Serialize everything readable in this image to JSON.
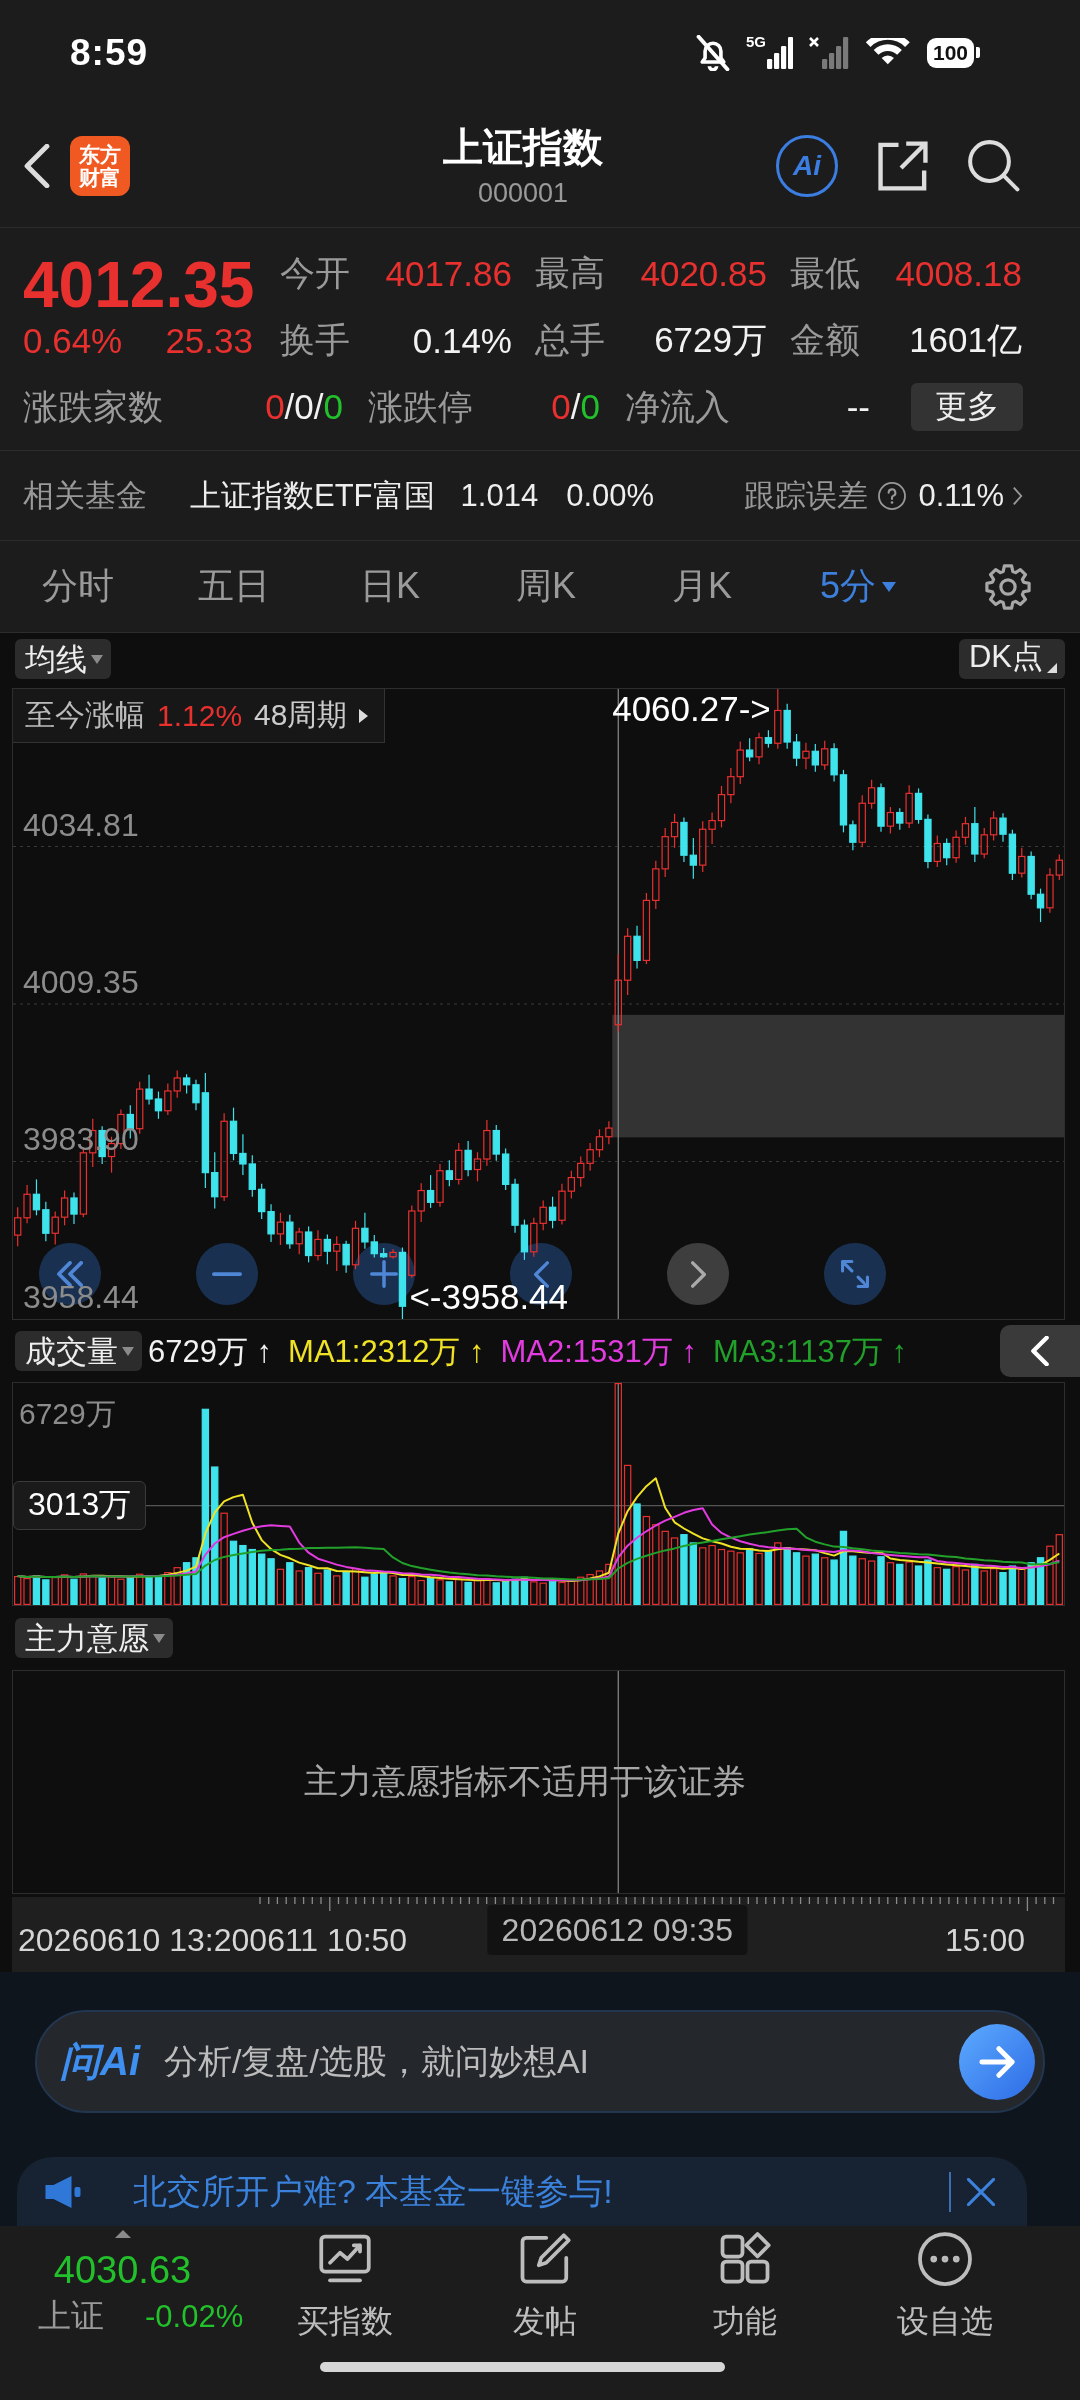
{
  "status_bar": {
    "time": "8:59",
    "network": "5G",
    "battery": "100"
  },
  "header": {
    "logo": [
      "东方",
      "财富"
    ],
    "title": "上证指数",
    "code": "000001",
    "ai_button": "Ai"
  },
  "quote": {
    "price": "4012.35",
    "change_pct": "0.64%",
    "change": "25.33",
    "stats": [
      {
        "label": "今开",
        "value": "4017.86",
        "color": "#e8302f"
      },
      {
        "label": "最高",
        "value": "4020.85",
        "color": "#e8302f"
      },
      {
        "label": "最低",
        "value": "4008.18",
        "color": "#e8302f"
      },
      {
        "label": "换手",
        "value": "0.14%",
        "color": "#f2f2f2"
      },
      {
        "label": "总手",
        "value": "6729万",
        "color": "#f2f2f2"
      },
      {
        "label": "金额",
        "value": "1601亿",
        "color": "#f2f2f2"
      }
    ],
    "breadth": [
      {
        "label": "涨跌家数",
        "parts": [
          {
            "text": "0",
            "color": "#e8302f"
          },
          {
            "text": "/0/",
            "color": "#f2f2f2"
          },
          {
            "text": "0",
            "color": "#22c02a"
          }
        ]
      },
      {
        "label": "涨跌停",
        "parts": [
          {
            "text": "0",
            "color": "#e8302f"
          },
          {
            "text": "/",
            "color": "#f2f2f2"
          },
          {
            "text": "0",
            "color": "#22c02a"
          }
        ]
      },
      {
        "label": "净流入",
        "parts": [
          {
            "text": "--",
            "color": "#f2f2f2"
          }
        ]
      }
    ],
    "more_button": "更多"
  },
  "related_fund": {
    "label": "相关基金",
    "name": "上证指数ETF富国",
    "price": "1.014",
    "change": "0.00%",
    "tracking_label": "跟踪误差",
    "tracking_value": "0.11%"
  },
  "period_tabs": [
    {
      "label": "分时",
      "selected": false,
      "kind": "plain"
    },
    {
      "label": "五日",
      "selected": false,
      "kind": "plain"
    },
    {
      "label": "日K",
      "selected": false,
      "kind": "plain"
    },
    {
      "label": "周K",
      "selected": false,
      "kind": "plain"
    },
    {
      "label": "月K",
      "selected": false,
      "kind": "plain"
    },
    {
      "label": "5分",
      "selected": true,
      "kind": "menu"
    }
  ],
  "kline": {
    "indicator": "均线",
    "dk_button": "DK点",
    "range_label": "至今涨幅",
    "range_change": "1.12%",
    "range_periods": "48周期",
    "controls": [
      {
        "disabled": false
      },
      {
        "disabled": false
      },
      {
        "disabled": false
      },
      {
        "disabled": false
      },
      {
        "disabled": true
      },
      {
        "disabled": false
      }
    ],
    "chart_data": {
      "type": "candlestick",
      "grid": true,
      "ohlc": [
        [
          3972.0,
          3976.5,
          3970.2,
          3974.8
        ],
        [
          3974.8,
          3980.1,
          3973.9,
          3978.6
        ],
        [
          3978.6,
          3981.0,
          3975.2,
          3976.1
        ],
        [
          3976.1,
          3977.4,
          3971.0,
          3972.3
        ],
        [
          3972.3,
          3975.8,
          3970.5,
          3974.9
        ],
        [
          3974.9,
          3979.2,
          3973.6,
          3978.0
        ],
        [
          3978.0,
          3978.9,
          3973.8,
          3975.4
        ],
        [
          3975.4,
          3986.2,
          3974.9,
          3985.3
        ],
        [
          3985.3,
          3990.8,
          3983.0,
          3988.9
        ],
        [
          3988.9,
          3989.6,
          3983.5,
          3984.7
        ],
        [
          3984.7,
          3987.9,
          3982.1,
          3986.8
        ],
        [
          3986.8,
          3992.3,
          3985.9,
          3991.5
        ],
        [
          3991.5,
          3993.0,
          3987.6,
          3989.2
        ],
        [
          3989.2,
          3996.8,
          3988.4,
          3995.6
        ],
        [
          3995.6,
          3997.9,
          3993.1,
          3994.0
        ],
        [
          3994.0,
          3995.2,
          3990.8,
          3992.1
        ],
        [
          3992.1,
          3996.5,
          3991.4,
          3995.3
        ],
        [
          3995.3,
          3998.6,
          3994.2,
          3997.4
        ],
        [
          3997.4,
          3998.0,
          3994.9,
          3996.3
        ],
        [
          3996.3,
          3997.1,
          3992.2,
          3993.4
        ],
        [
          3995.0,
          3998.2,
          3979.6,
          3982.1
        ],
        [
          3982.1,
          3985.4,
          3976.3,
          3978.2
        ],
        [
          3978.2,
          3991.7,
          3977.5,
          3990.4
        ],
        [
          3990.4,
          3992.6,
          3984.1,
          3985.2
        ],
        [
          3985.2,
          3988.3,
          3981.7,
          3983.5
        ],
        [
          3983.5,
          3984.9,
          3978.2,
          3979.4
        ],
        [
          3979.4,
          3980.3,
          3974.6,
          3975.8
        ],
        [
          3975.8,
          3977.0,
          3970.9,
          3972.2
        ],
        [
          3972.2,
          3975.6,
          3970.4,
          3974.1
        ],
        [
          3974.1,
          3975.3,
          3969.8,
          3970.6
        ],
        [
          3970.6,
          3973.2,
          3968.9,
          3972.5
        ],
        [
          3972.5,
          3973.4,
          3967.6,
          3968.7
        ],
        [
          3968.7,
          3972.8,
          3967.9,
          3971.3
        ],
        [
          3971.3,
          3972.1,
          3967.3,
          3969.4
        ],
        [
          3969.4,
          3971.8,
          3966.2,
          3970.5
        ],
        [
          3970.5,
          3971.1,
          3965.9,
          3967.2
        ],
        [
          3967.2,
          3974.3,
          3966.5,
          3973.1
        ],
        [
          3973.1,
          3975.6,
          3969.8,
          3970.9
        ],
        [
          3970.9,
          3972.0,
          3968.4,
          3969.0
        ],
        [
          3969.0,
          3969.9,
          3968.3,
          3968.5
        ],
        [
          3968.5,
          3969.7,
          3968.2,
          3969.2
        ],
        [
          3969.2,
          3970.0,
          3958.44,
          3960.5
        ],
        [
          3965.5,
          3976.8,
          3965.1,
          3975.9
        ],
        [
          3975.9,
          3980.4,
          3974.1,
          3979.2
        ],
        [
          3979.2,
          3981.7,
          3976.4,
          3977.3
        ],
        [
          3977.3,
          3983.5,
          3976.6,
          3982.4
        ],
        [
          3982.4,
          3984.1,
          3979.9,
          3981.0
        ],
        [
          3981.0,
          3986.9,
          3980.2,
          3985.7
        ],
        [
          3985.7,
          3987.2,
          3981.5,
          3982.6
        ],
        [
          3982.6,
          3985.4,
          3980.7,
          3984.3
        ],
        [
          3984.3,
          3990.6,
          3983.2,
          3988.9
        ],
        [
          3988.9,
          3989.8,
          3984.0,
          3985.1
        ],
        [
          3985.1,
          3986.0,
          3979.3,
          3980.2
        ],
        [
          3980.2,
          3981.1,
          3972.4,
          3973.6
        ],
        [
          3973.6,
          3974.5,
          3968.0,
          3969.3
        ],
        [
          3969.3,
          3974.8,
          3968.5,
          3973.9
        ],
        [
          3973.9,
          3977.6,
          3972.8,
          3976.5
        ],
        [
          3976.5,
          3978.2,
          3973.1,
          3974.4
        ],
        [
          3974.4,
          3980.3,
          3973.7,
          3979.1
        ],
        [
          3979.1,
          3982.4,
          3977.9,
          3981.3
        ],
        [
          3981.3,
          3984.7,
          3979.8,
          3983.6
        ],
        [
          3983.6,
          3986.9,
          3982.4,
          3985.8
        ],
        [
          3985.8,
          3989.1,
          3984.6,
          3987.9
        ],
        [
          3987.9,
          3990.4,
          3986.7,
          3989.3
        ],
        [
          4006.0,
          4017.4,
          4004.9,
          4013.2
        ],
        [
          4013.2,
          4021.6,
          4010.8,
          4020.3
        ],
        [
          4020.3,
          4022.0,
          4015.1,
          4016.4
        ],
        [
          4016.4,
          4027.3,
          4015.8,
          4026.1
        ],
        [
          4026.1,
          4032.5,
          4024.7,
          4031.2
        ],
        [
          4031.2,
          4037.8,
          4029.9,
          4036.4
        ],
        [
          4036.4,
          4040.1,
          4034.6,
          4038.7
        ],
        [
          4038.7,
          4039.5,
          4032.3,
          4033.4
        ],
        [
          4033.4,
          4036.2,
          4029.6,
          4031.8
        ],
        [
          4031.8,
          4038.9,
          4030.7,
          4037.6
        ],
        [
          4037.6,
          4040.3,
          4035.2,
          4039.0
        ],
        [
          4039.0,
          4044.6,
          4037.9,
          4043.2
        ],
        [
          4043.2,
          4047.5,
          4041.8,
          4046.1
        ],
        [
          4046.1,
          4051.8,
          4044.9,
          4050.4
        ],
        [
          4050.4,
          4052.3,
          4048.6,
          4049.3
        ],
        [
          4049.3,
          4053.2,
          4048.1,
          4052.4
        ],
        [
          4052.4,
          4053.6,
          4050.8,
          4051.5
        ],
        [
          4051.5,
          4060.27,
          4050.6,
          4056.8
        ],
        [
          4056.8,
          4057.9,
          4050.6,
          4051.7
        ],
        [
          4051.7,
          4053.0,
          4047.8,
          4049.1
        ],
        [
          4049.1,
          4051.6,
          4047.3,
          4050.2
        ],
        [
          4050.2,
          4051.4,
          4046.9,
          4048.0
        ],
        [
          4048.0,
          4051.9,
          4047.2,
          4050.6
        ],
        [
          4050.6,
          4051.5,
          4045.3,
          4046.4
        ],
        [
          4046.4,
          4047.2,
          4037.1,
          4038.3
        ],
        [
          4038.3,
          4039.0,
          4034.2,
          4035.5
        ],
        [
          4035.5,
          4043.1,
          4034.7,
          4041.8
        ],
        [
          4041.8,
          4045.6,
          4040.9,
          4044.3
        ],
        [
          4044.3,
          4045.0,
          4037.2,
          4038.1
        ],
        [
          4038.1,
          4041.2,
          4036.9,
          4040.3
        ],
        [
          4040.3,
          4041.0,
          4037.5,
          4038.6
        ],
        [
          4038.6,
          4044.7,
          4037.8,
          4043.4
        ],
        [
          4043.4,
          4044.2,
          4038.5,
          4039.2
        ],
        [
          4039.2,
          4040.0,
          4031.3,
          4032.4
        ],
        [
          4032.4,
          4036.6,
          4031.5,
          4035.3
        ],
        [
          4035.3,
          4036.1,
          4031.8,
          4033.0
        ],
        [
          4033.0,
          4037.4,
          4032.2,
          4036.3
        ],
        [
          4036.3,
          4039.6,
          4035.1,
          4038.5
        ],
        [
          4038.5,
          4041.2,
          4032.3,
          4033.6
        ],
        [
          4033.6,
          4037.8,
          4032.9,
          4036.7
        ],
        [
          4036.7,
          4040.5,
          4035.8,
          4039.4
        ],
        [
          4039.4,
          4040.2,
          4035.6,
          4036.8
        ],
        [
          4036.8,
          4037.5,
          4029.4,
          4030.5
        ],
        [
          4030.5,
          4034.6,
          4029.8,
          4033.2
        ],
        [
          4033.2,
          4034.0,
          4026.3,
          4027.1
        ],
        [
          4027.1,
          4028.0,
          4022.6,
          4024.9
        ],
        [
          4024.9,
          4031.3,
          4024.1,
          4030.2
        ],
        [
          4030.2,
          4033.5,
          4029.4,
          4032.6
        ]
      ],
      "ylim": [
        3958.44,
        4060.27
      ],
      "yticks": [
        4034.81,
        4009.35,
        {
          "value": 3983.9,
          "label": "3983.90"
        },
        3958.44
      ],
      "annotations": [
        "4060.27->",
        "<-3958.44"
      ]
    }
  },
  "volume": {
    "indicator": "成交量",
    "legend": [
      {
        "text": "6729万 ↑",
        "color": "#f2f2f2"
      },
      {
        "text": "MA1:2312万 ↑",
        "color": "#f0e324"
      },
      {
        "text": "MA2:1531万 ↑",
        "color": "#e23be0"
      },
      {
        "text": "MA3:1137万 ↑",
        "color": "#22a12a"
      }
    ],
    "max_label": "6729万",
    "reference_label": "3013万"
  },
  "main_force": {
    "indicator": "主力意愿",
    "message": "主力意愿指标不适用于该证券"
  },
  "time_axis": {
    "labels": [
      "20260610 13:20",
      "0611 10:50",
      "15:00"
    ],
    "cursor_label": "20260612 09:35"
  },
  "ai_bar": {
    "logo": "问Ai",
    "placeholder": "分析/复盘/选股，就问妙想AI"
  },
  "banner": {
    "text": "北交所开户难? 本基金一键参与!"
  },
  "bottom_bar": {
    "index_value": "4030.63",
    "index_name": "上证",
    "index_change": "-0.02%",
    "items": [
      {
        "label": "买指数"
      },
      {
        "label": "发帖"
      },
      {
        "label": "功能"
      },
      {
        "label": "设自选"
      }
    ]
  }
}
